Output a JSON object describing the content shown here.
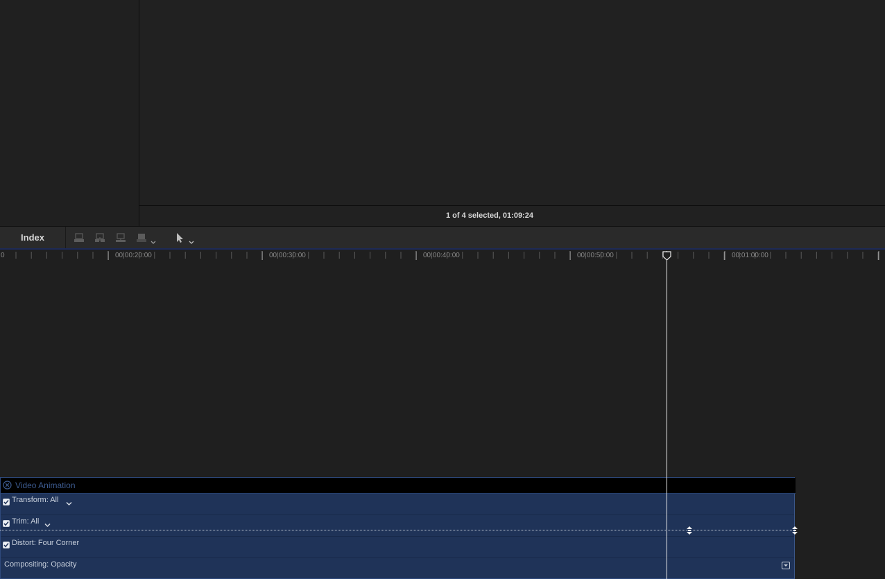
{
  "viewer": {
    "selection_status": "1 of 4 selected, 01:09:24"
  },
  "toolbar": {
    "index_label": "Index",
    "icons": [
      "append-clip-icon",
      "insert-clip-icon",
      "connect-clip-icon",
      "overwrite-clip-icon",
      "select-tool-icon"
    ]
  },
  "ruler": {
    "labels": [
      "0",
      "00:00:20:00",
      "00:00:30:00",
      "00:00:40:00",
      "00:00:50:00",
      "00:01:00:00"
    ]
  },
  "clip": {
    "title": "Video Animation",
    "lanes": [
      {
        "label": "Transform: All",
        "checked": true,
        "has_menu": true
      },
      {
        "label": "Trim: All",
        "checked": true,
        "has_menu": true
      },
      {
        "label": "Distort: Four Corner",
        "checked": true,
        "has_menu": false
      },
      {
        "label": "Compositing: Opacity",
        "checked": false,
        "has_menu": false
      }
    ]
  },
  "colors": {
    "clip_fill": "#1f3358",
    "clip_header": "#000000",
    "playhead": "#e8e8e8",
    "background": "#1f1f1f"
  }
}
